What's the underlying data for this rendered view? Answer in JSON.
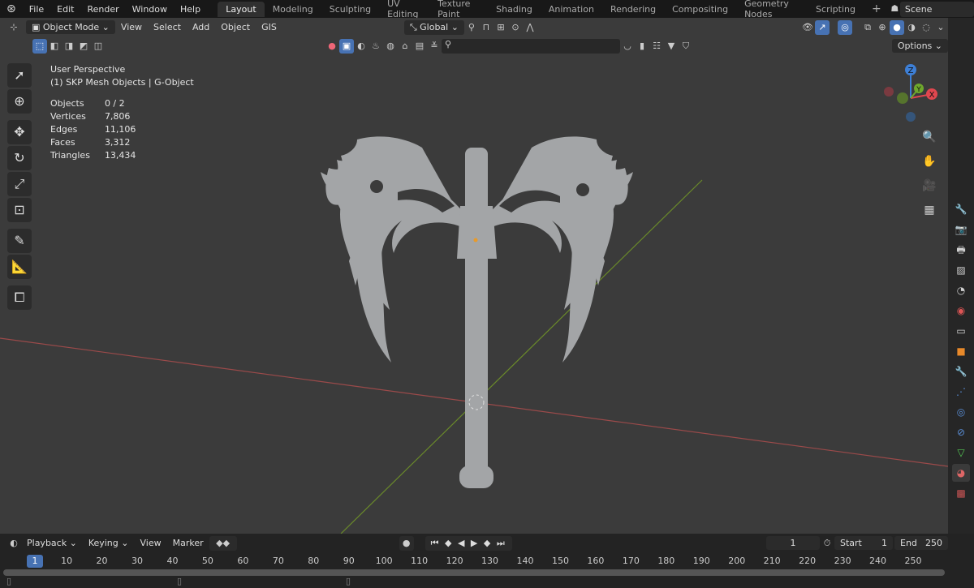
{
  "topbar": {
    "menus": [
      "File",
      "Edit",
      "Render",
      "Window",
      "Help"
    ],
    "workspaces": [
      "Layout",
      "Modeling",
      "Sculpting",
      "UV Editing",
      "Texture Paint",
      "Shading",
      "Animation",
      "Rendering",
      "Compositing",
      "Geometry Nodes",
      "Scripting"
    ],
    "active_workspace": "Layout",
    "add_tab": "+",
    "scene": "Scene"
  },
  "header": {
    "mode": "Object Mode",
    "menus": [
      "View",
      "Select",
      "Add",
      "Object",
      "GIS"
    ],
    "orientation": "Global",
    "options": "Options"
  },
  "overlay": {
    "view_name": "User Perspective",
    "collection": "(1) SKP Mesh Objects | G-Object",
    "stats": [
      {
        "label": "Objects",
        "value": "0 / 2"
      },
      {
        "label": "Vertices",
        "value": "7,806"
      },
      {
        "label": "Edges",
        "value": "11,106"
      },
      {
        "label": "Faces",
        "value": "3,312"
      },
      {
        "label": "Triangles",
        "value": "13,434"
      }
    ]
  },
  "gizmo": {
    "x": "X",
    "y": "Y",
    "z": "Z",
    "x_color": "#e0474f",
    "y_color": "#6fa82d",
    "z_color": "#3d7fd6"
  },
  "timeline": {
    "menus": [
      "Playback",
      "Keying",
      "View",
      "Marker"
    ],
    "current_frame": "1",
    "start_label": "Start",
    "start": "1",
    "end_label": "End",
    "end": "250",
    "ticks": [
      "1",
      "10",
      "20",
      "30",
      "40",
      "50",
      "60",
      "70",
      "80",
      "90",
      "100",
      "110",
      "120",
      "130",
      "140",
      "150",
      "160",
      "170",
      "180",
      "190",
      "200",
      "210",
      "220",
      "230",
      "240",
      "250"
    ]
  },
  "colors": {
    "accent": "#4772b3",
    "viewport": "#3b3b3b",
    "mesh": "#a3a5a7"
  }
}
